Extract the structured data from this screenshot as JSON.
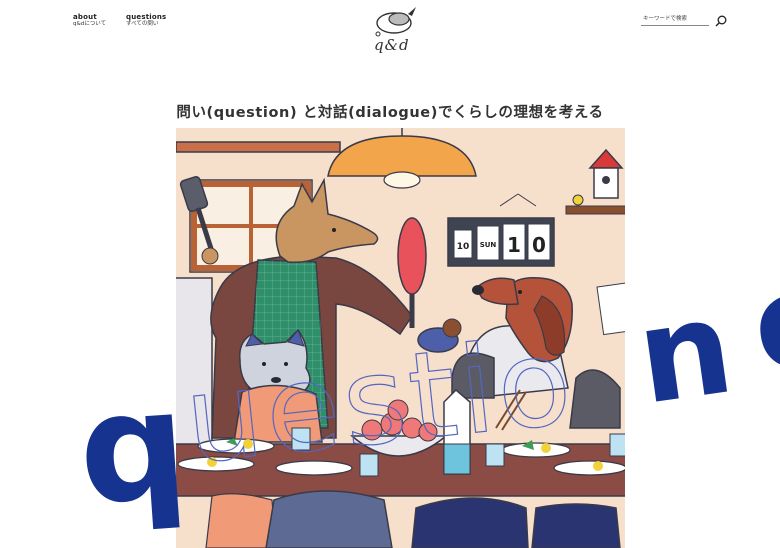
{
  "nav": {
    "about": {
      "label": "about",
      "sub": "q&dについて"
    },
    "questions": {
      "label": "questions",
      "sub": "すべての問い"
    }
  },
  "logo": {
    "text": "q&d"
  },
  "search": {
    "placeholder": "キーワードで検索",
    "icon": "search-icon"
  },
  "hero": {
    "title": "問い(question) と対話(dialogue)でくらしの理想を考える",
    "calendar": {
      "month": "10",
      "weekday": "SUN",
      "day_tens": "1",
      "day_ones": "0"
    },
    "overlay_word": "question"
  },
  "colors": {
    "accent_blue": "#16348f",
    "outline": "#3a3a48",
    "wall": "#f6e0cc"
  }
}
